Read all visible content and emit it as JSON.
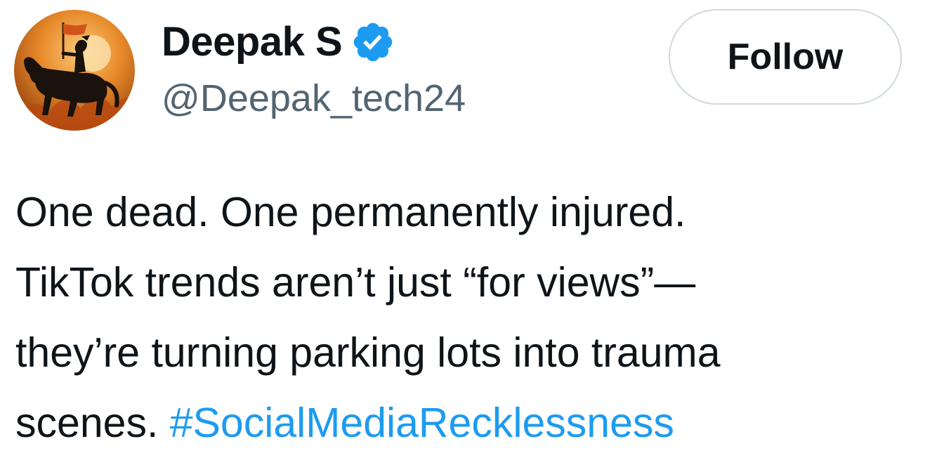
{
  "author": {
    "display_name": "Deepak S",
    "handle": "@Deepak_tech24",
    "verified": true,
    "verified_color": "#1d9bf0",
    "avatar_icon": "horse-rider-avatar"
  },
  "follow_button": {
    "label": "Follow"
  },
  "tweet": {
    "lines": [
      "One dead. One permanently injured.",
      "TikTok trends aren’t just “for views”—",
      "they’re turning parking lots into trauma"
    ],
    "last_line_text": "scenes. ",
    "hashtag": "#SocialMediaRecklessness",
    "hashtag_color": "#1d9bf0"
  }
}
